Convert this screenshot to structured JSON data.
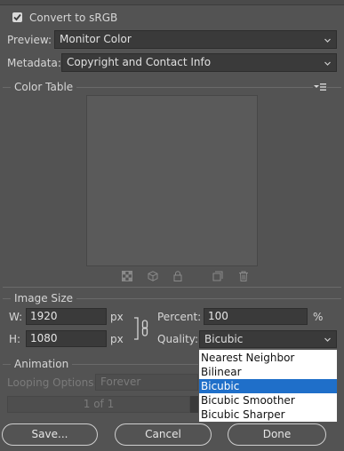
{
  "color_section": {
    "convert_srgb_label": "Convert to sRGB",
    "convert_srgb_checked": true,
    "preview_label": "Preview:",
    "preview_value": "Monitor Color",
    "metadata_label": "Metadata:",
    "metadata_value": "Copyright and Contact Info"
  },
  "color_table": {
    "title": "Color Table",
    "menu_icon": "panel-menu-icon",
    "tools": [
      "transparency-map-icon",
      "web-cube-icon",
      "lock-icon",
      "new-color-icon",
      "trash-icon"
    ]
  },
  "image_size": {
    "title": "Image Size",
    "w_label": "W:",
    "w_value": "1920",
    "w_unit": "px",
    "h_label": "H:",
    "h_value": "1080",
    "h_unit": "px",
    "link_icon": "chain-link-icon",
    "percent_label": "Percent:",
    "percent_value": "100",
    "percent_unit": "%",
    "quality_label": "Quality:",
    "quality_value": "Bicubic",
    "quality_options": [
      "Nearest Neighbor",
      "Bilinear",
      "Bicubic",
      "Bicubic Smoother",
      "Bicubic Sharper"
    ],
    "quality_selected": "Bicubic"
  },
  "animation": {
    "title": "Animation",
    "looping_label": "Looping Options:",
    "looping_value": "Forever",
    "frame_counter": "1 of 1"
  },
  "buttons": {
    "save": "Save...",
    "cancel": "Cancel",
    "done": "Done"
  },
  "colors": {
    "background": "#535353",
    "field": "#3a3a3a",
    "highlight": "#1f6fc9"
  }
}
